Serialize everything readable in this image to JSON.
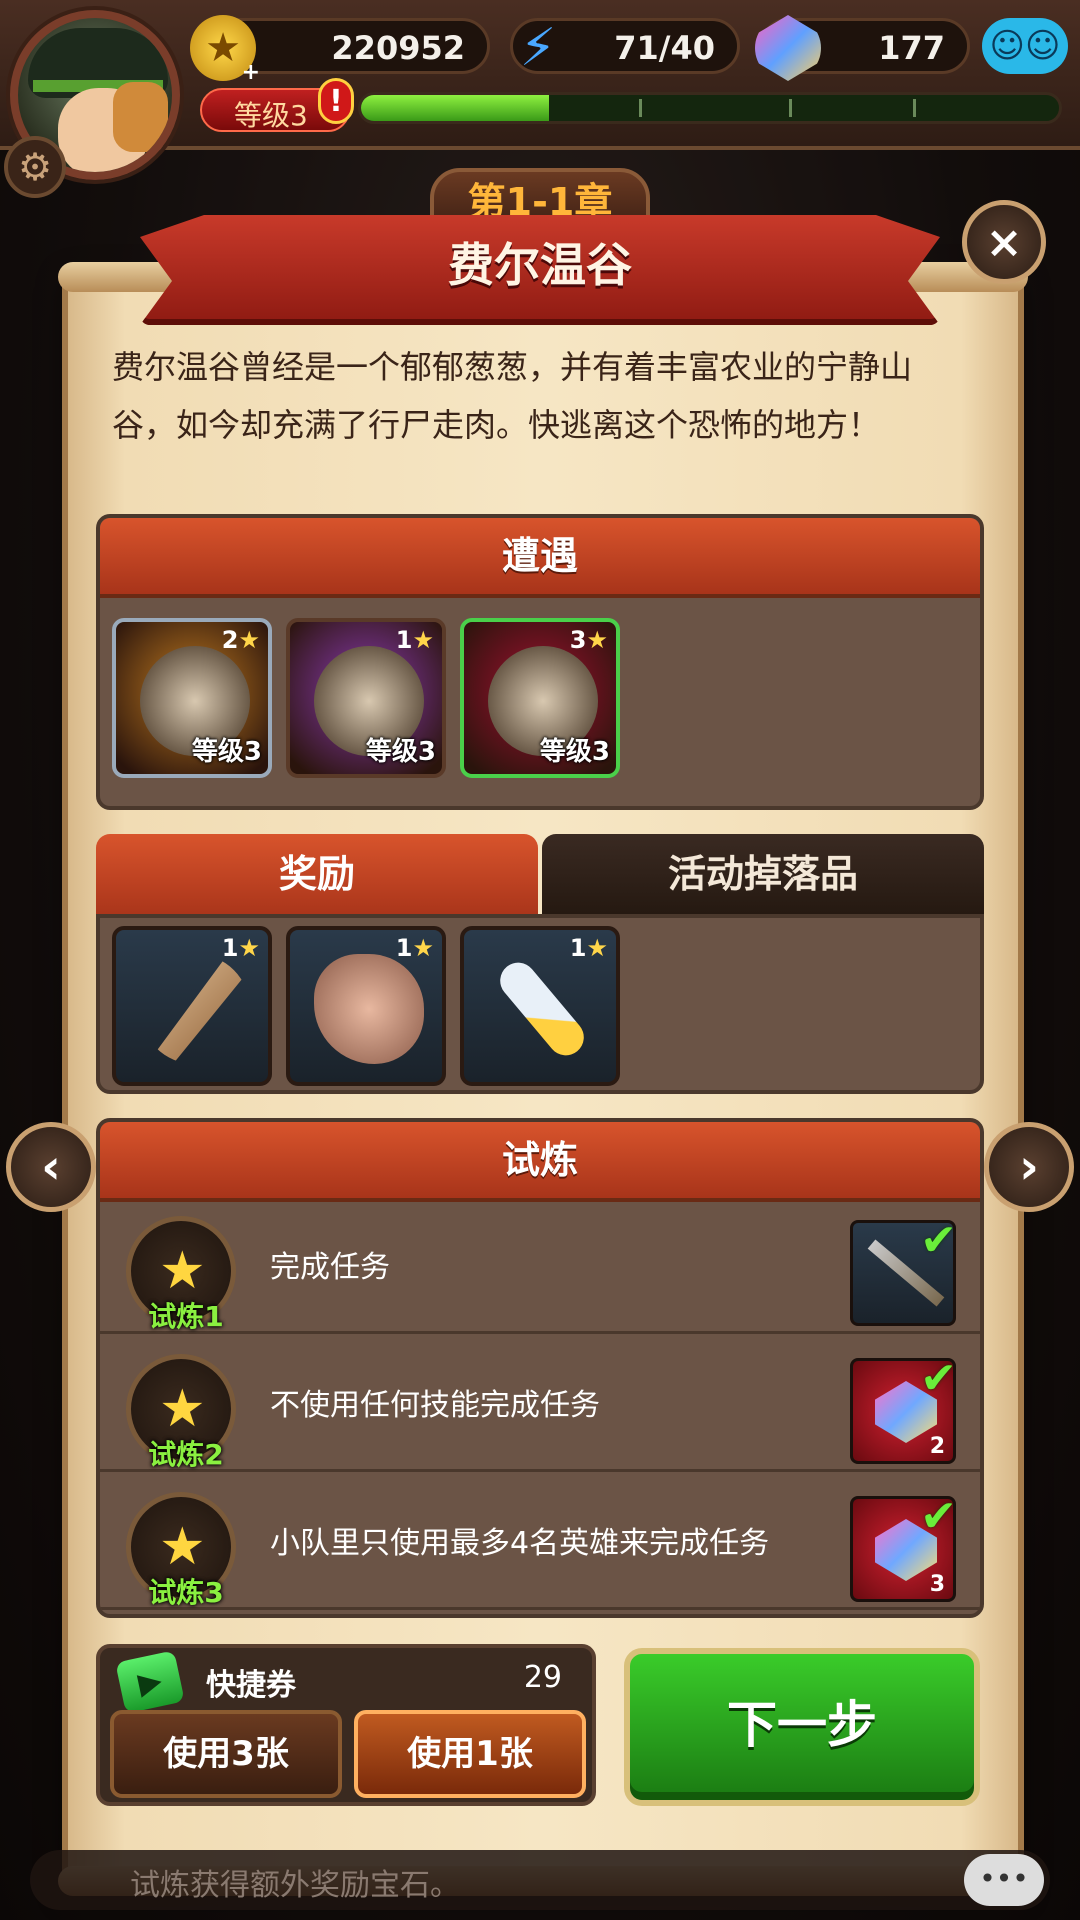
{
  "hud": {
    "gold": "220952",
    "energy": "71/40",
    "gems": "177",
    "level_label": "等级3",
    "level_alert": "!",
    "xp_progress": 0.27
  },
  "dialog": {
    "chapter": "第1-1章",
    "title": "费尔温谷",
    "close": "×",
    "description": "费尔温谷曾经是一个郁郁葱葱，并有着丰富农业的宁静山谷，如今却充满了行尸走肉。快逃离这个恐怖的地方！"
  },
  "encounter": {
    "heading": "遭遇",
    "enemies": [
      {
        "stars": "2",
        "level": "等级3",
        "icon": "zombie-icon",
        "bg": "#c07a20",
        "frame": "#9aaabb"
      },
      {
        "stars": "1",
        "level": "等级3",
        "icon": "ghoul-icon",
        "bg": "#8a3ab0",
        "frame": "#5a3a28"
      },
      {
        "stars": "3",
        "level": "等级3",
        "icon": "hooded-ghoul-icon",
        "bg": "#a01030",
        "frame": "#4ad04a"
      }
    ]
  },
  "rewards": {
    "tab_rewards": "奖励",
    "tab_event": "活动掉落品",
    "items": [
      {
        "stars": "1",
        "icon": "feather-icon"
      },
      {
        "stars": "1",
        "icon": "rock-icon"
      },
      {
        "stars": "1",
        "icon": "vial-icon"
      }
    ]
  },
  "trials": {
    "heading": "试炼",
    "rows": [
      {
        "name": "试炼1",
        "text": "完成任务",
        "reward_icon": "sword-icon",
        "reward_count": ""
      },
      {
        "name": "试炼2",
        "text": "不使用任何技能完成任务",
        "reward_icon": "gem-icon",
        "reward_count": "2"
      },
      {
        "name": "试炼3",
        "text": "小队里只使用最多4名英雄来完成任务",
        "reward_icon": "gem-icon",
        "reward_count": "3"
      }
    ]
  },
  "ticket": {
    "label": "快捷券",
    "count": "29",
    "use3": "使用3张",
    "use1": "使用1张"
  },
  "next": "下一步",
  "chat_text": "试炼获得额外奖励宝石。"
}
